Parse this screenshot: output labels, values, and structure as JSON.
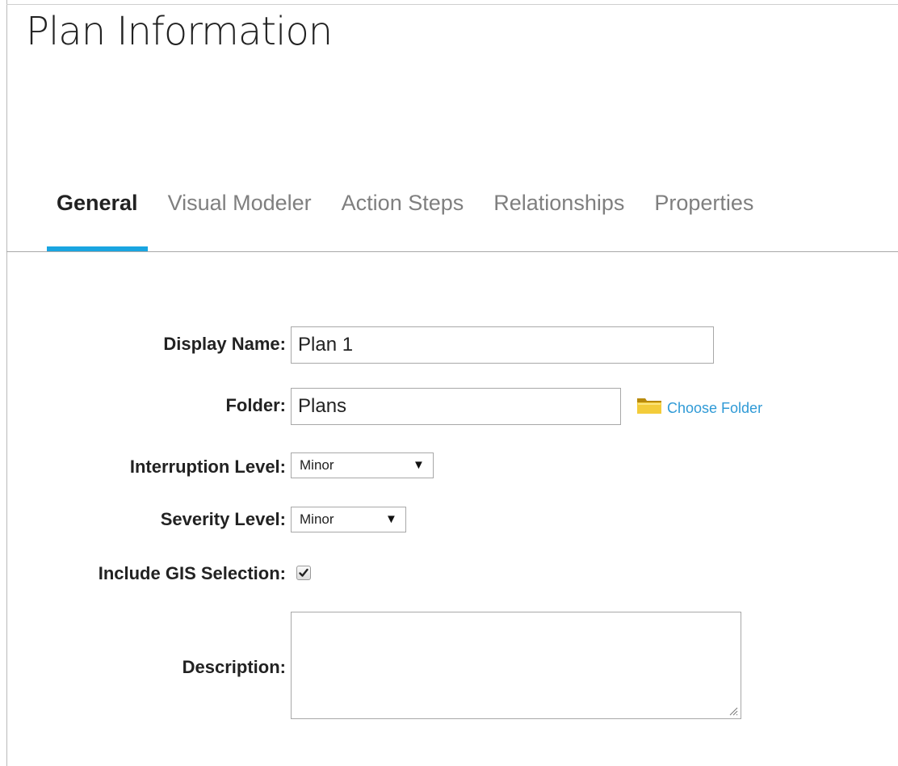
{
  "page": {
    "title": "Plan Information"
  },
  "tabs": [
    {
      "label": "General",
      "active": true
    },
    {
      "label": "Visual Modeler",
      "active": false
    },
    {
      "label": "Action Steps",
      "active": false
    },
    {
      "label": "Relationships",
      "active": false
    },
    {
      "label": "Properties",
      "active": false
    }
  ],
  "form": {
    "display_name": {
      "label": "Display Name:",
      "value": "Plan 1"
    },
    "folder": {
      "label": "Folder:",
      "value": "Plans",
      "choose_label": "Choose Folder",
      "icon": "folder-icon"
    },
    "interruption_level": {
      "label": "Interruption Level:",
      "selected": "Minor"
    },
    "severity_level": {
      "label": "Severity Level:",
      "selected": "Minor"
    },
    "include_gis": {
      "label": "Include GIS Selection:",
      "checked": true
    },
    "description": {
      "label": "Description:",
      "value": ""
    }
  },
  "colors": {
    "accent": "#19a5e1",
    "link": "#2f9ad6",
    "inactive_tab": "#7f7f7f",
    "text": "#222222"
  }
}
